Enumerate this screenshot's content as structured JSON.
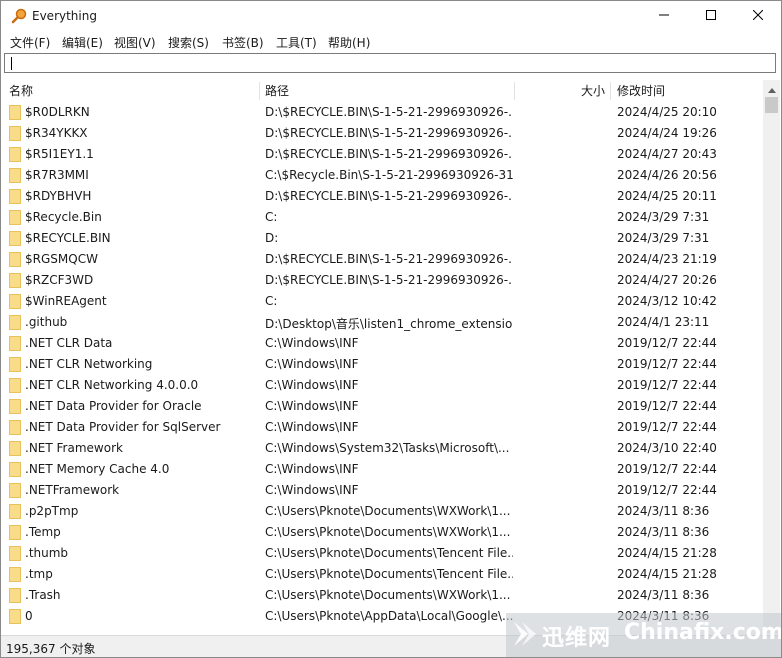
{
  "window": {
    "title": "Everything"
  },
  "menu": [
    {
      "label": "文件(F)"
    },
    {
      "label": "编辑(E)"
    },
    {
      "label": "视图(V)"
    },
    {
      "label": "搜索(S)"
    },
    {
      "label": "书签(B)"
    },
    {
      "label": "工具(T)"
    },
    {
      "label": "帮助(H)"
    }
  ],
  "search": {
    "value": "",
    "placeholder": ""
  },
  "columns": {
    "name": "名称",
    "path": "路径",
    "size": "大小",
    "modified": "修改时间"
  },
  "rows": [
    {
      "name": "$R0DLRKN",
      "path": "D:\\$RECYCLE.BIN\\S-1-5-21-2996930926-...",
      "modified": "2024/4/25 20:10"
    },
    {
      "name": "$R34YKKX",
      "path": "D:\\$RECYCLE.BIN\\S-1-5-21-2996930926-...",
      "modified": "2024/4/24 19:26"
    },
    {
      "name": "$R5I1EY1.1",
      "path": "D:\\$RECYCLE.BIN\\S-1-5-21-2996930926-...",
      "modified": "2024/4/27 20:43"
    },
    {
      "name": "$R7R3MMI",
      "path": "C:\\$Recycle.Bin\\S-1-5-21-2996930926-31...",
      "modified": "2024/4/26 20:56"
    },
    {
      "name": "$RDYBHVH",
      "path": "D:\\$RECYCLE.BIN\\S-1-5-21-2996930926-...",
      "modified": "2024/4/25 20:11"
    },
    {
      "name": "$Recycle.Bin",
      "path": "C:",
      "modified": "2024/3/29 7:31"
    },
    {
      "name": "$RECYCLE.BIN",
      "path": "D:",
      "modified": "2024/3/29 7:31"
    },
    {
      "name": "$RGSMQCW",
      "path": "D:\\$RECYCLE.BIN\\S-1-5-21-2996930926-...",
      "modified": "2024/4/23 21:19"
    },
    {
      "name": "$RZCF3WD",
      "path": "D:\\$RECYCLE.BIN\\S-1-5-21-2996930926-...",
      "modified": "2024/4/27 20:26"
    },
    {
      "name": "$WinREAgent",
      "path": "C:",
      "modified": "2024/3/12 10:42"
    },
    {
      "name": ".github",
      "path": "D:\\Desktop\\音乐\\listen1_chrome_extensio...",
      "modified": "2024/4/1 23:11"
    },
    {
      "name": ".NET CLR Data",
      "path": "C:\\Windows\\INF",
      "modified": "2019/12/7 22:44"
    },
    {
      "name": ".NET CLR Networking",
      "path": "C:\\Windows\\INF",
      "modified": "2019/12/7 22:44"
    },
    {
      "name": ".NET CLR Networking 4.0.0.0",
      "path": "C:\\Windows\\INF",
      "modified": "2019/12/7 22:44"
    },
    {
      "name": ".NET Data Provider for Oracle",
      "path": "C:\\Windows\\INF",
      "modified": "2019/12/7 22:44"
    },
    {
      "name": ".NET Data Provider for SqlServer",
      "path": "C:\\Windows\\INF",
      "modified": "2019/12/7 22:44"
    },
    {
      "name": ".NET Framework",
      "path": "C:\\Windows\\System32\\Tasks\\Microsoft\\...",
      "modified": "2024/3/10 22:40"
    },
    {
      "name": ".NET Memory Cache 4.0",
      "path": "C:\\Windows\\INF",
      "modified": "2019/12/7 22:44"
    },
    {
      "name": ".NETFramework",
      "path": "C:\\Windows\\INF",
      "modified": "2019/12/7 22:44"
    },
    {
      "name": ".p2pTmp",
      "path": "C:\\Users\\Pknote\\Documents\\WXWork\\1...",
      "modified": "2024/3/11 8:36"
    },
    {
      "name": ".Temp",
      "path": "C:\\Users\\Pknote\\Documents\\WXWork\\1...",
      "modified": "2024/3/11 8:36"
    },
    {
      "name": ".thumb",
      "path": "C:\\Users\\Pknote\\Documents\\Tencent File...",
      "modified": "2024/4/15 21:28"
    },
    {
      "name": ".tmp",
      "path": "C:\\Users\\Pknote\\Documents\\Tencent File...",
      "modified": "2024/4/15 21:28"
    },
    {
      "name": ".Trash",
      "path": "C:\\Users\\Pknote\\Documents\\WXWork\\1...",
      "modified": "2024/3/11 8:36"
    },
    {
      "name": "0",
      "path": "C:\\Users\\Pknote\\AppData\\Local\\Google\\...",
      "modified": "2024/3/11 8:36"
    }
  ],
  "status": {
    "text": "195,367 个对象"
  },
  "watermark": {
    "cn": "迅维网",
    "en": "Chinafix.com"
  },
  "colors": {
    "folder": "#f8dc8a",
    "app_icon": "#e0821f",
    "close": "#000000"
  },
  "icons": {
    "app": "magnifier-icon",
    "folder": "folder-icon",
    "minimize": "minimize-icon",
    "maximize": "maximize-icon",
    "close": "close-icon"
  }
}
